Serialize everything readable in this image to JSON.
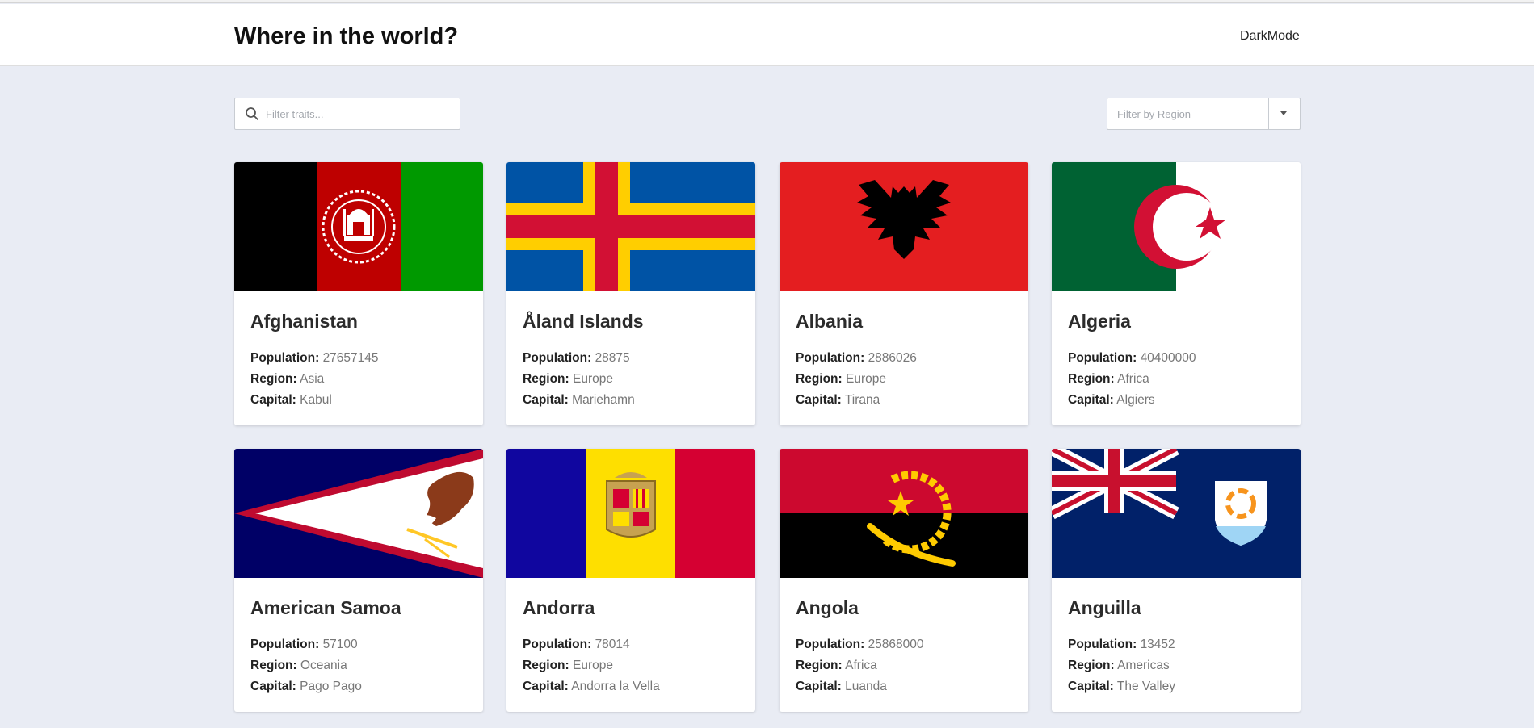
{
  "header": {
    "title": "Where in the world?",
    "darkmode_label": "DarkMode"
  },
  "search": {
    "placeholder": "Filter traits...",
    "icon": "search-icon"
  },
  "region_filter": {
    "placeholder": "Filter by Region",
    "icon": "chevron-down-icon"
  },
  "labels": {
    "population": "Population:",
    "region": "Region:",
    "capital": "Capital:"
  },
  "countries": [
    {
      "name": "Afghanistan",
      "population": "27657145",
      "region": "Asia",
      "capital": "Kabul"
    },
    {
      "name": "Åland Islands",
      "population": "28875",
      "region": "Europe",
      "capital": "Mariehamn"
    },
    {
      "name": "Albania",
      "population": "2886026",
      "region": "Europe",
      "capital": "Tirana"
    },
    {
      "name": "Algeria",
      "population": "40400000",
      "region": "Africa",
      "capital": "Algiers"
    },
    {
      "name": "American Samoa",
      "population": "57100",
      "region": "Oceania",
      "capital": "Pago Pago"
    },
    {
      "name": "Andorra",
      "population": "78014",
      "region": "Europe",
      "capital": "Andorra la Vella"
    },
    {
      "name": "Angola",
      "population": "25868000",
      "region": "Africa",
      "capital": "Luanda"
    },
    {
      "name": "Anguilla",
      "population": "13452",
      "region": "Americas",
      "capital": "The Valley"
    }
  ]
}
